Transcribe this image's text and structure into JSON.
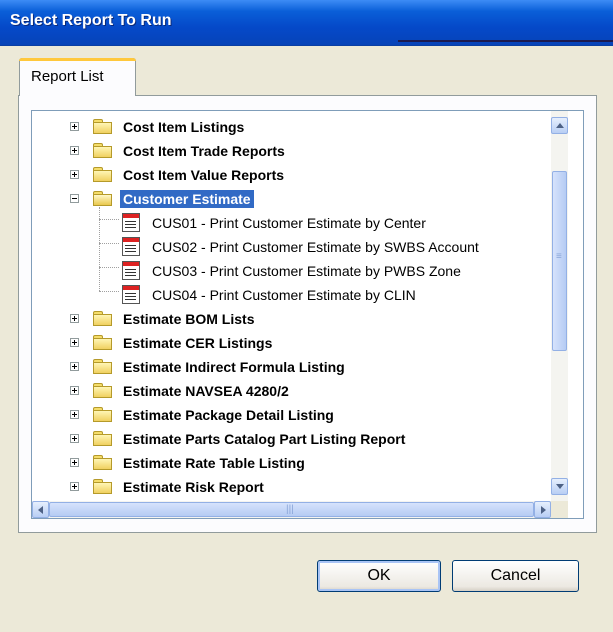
{
  "window": {
    "title": "Select Report To Run"
  },
  "tabs": [
    {
      "label": "Report List"
    }
  ],
  "tree": {
    "items": [
      {
        "label": "Cost Item Listings",
        "type": "folder",
        "expanded": false
      },
      {
        "label": "Cost Item Trade Reports",
        "type": "folder",
        "expanded": false
      },
      {
        "label": "Cost Item Value Reports",
        "type": "folder",
        "expanded": false
      },
      {
        "label": "Customer Estimate",
        "type": "folder",
        "expanded": true,
        "selected": true
      },
      {
        "label": "CUS01 - Print Customer Estimate by Center",
        "type": "report"
      },
      {
        "label": "CUS02 - Print Customer Estimate by SWBS Account",
        "type": "report"
      },
      {
        "label": "CUS03 - Print Customer Estimate by PWBS Zone",
        "type": "report"
      },
      {
        "label": "CUS04 - Print Customer Estimate by CLIN",
        "type": "report"
      },
      {
        "label": "Estimate BOM Lists",
        "type": "folder",
        "expanded": false
      },
      {
        "label": "Estimate CER Listings",
        "type": "folder",
        "expanded": false
      },
      {
        "label": "Estimate Indirect Formula Listing",
        "type": "folder",
        "expanded": false
      },
      {
        "label": "Estimate NAVSEA 4280/2",
        "type": "folder",
        "expanded": false
      },
      {
        "label": "Estimate Package Detail Listing",
        "type": "folder",
        "expanded": false
      },
      {
        "label": "Estimate Parts Catalog Part Listing Report",
        "type": "folder",
        "expanded": false
      },
      {
        "label": "Estimate Rate Table Listing",
        "type": "folder",
        "expanded": false
      },
      {
        "label": "Estimate Risk Report",
        "type": "folder",
        "expanded": false
      }
    ]
  },
  "buttons": {
    "ok": "OK",
    "cancel": "Cancel"
  },
  "colors": {
    "titlebar": "#0549c9",
    "selection": "#316ac5",
    "dialog_bg": "#ece9d8"
  }
}
